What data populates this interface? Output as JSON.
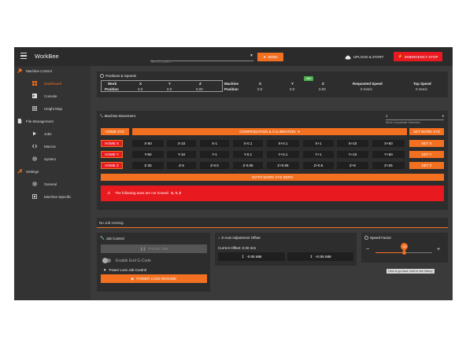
{
  "app": {
    "title": "WorkBee"
  },
  "topbar": {
    "send_placeholder": "Send code...",
    "send_label": "SEND",
    "upload_label": "UPLOAD & START",
    "estop_label": "EMERGENCY STOP",
    "accent": "#f37021",
    "danger": "#e8191f"
  },
  "sidebar": {
    "sections": [
      {
        "label": "Machine Control",
        "icon": "tools-icon",
        "items": [
          {
            "label": "Dashboard",
            "icon": "dashboard-icon",
            "active": true
          },
          {
            "label": "Console",
            "icon": "console-icon"
          },
          {
            "label": "Height Map",
            "icon": "grid-icon"
          }
        ]
      },
      {
        "label": "File Management",
        "icon": "file-icon",
        "items": [
          {
            "label": "Jobs",
            "icon": "play-icon"
          },
          {
            "label": "Macros",
            "icon": "code-icon"
          },
          {
            "label": "System",
            "icon": "gear-icon"
          }
        ]
      },
      {
        "label": "Settings",
        "icon": "wrench-icon",
        "items": [
          {
            "label": "General",
            "icon": "gear-icon"
          },
          {
            "label": "Machine-Specific",
            "icon": "chip-icon"
          }
        ]
      }
    ]
  },
  "positions": {
    "title": "Positions & Speeds",
    "status": "Idle",
    "work_label": "Work",
    "position_label": "Position",
    "machine_label": "Machine",
    "x": "X",
    "y": "Y",
    "z": "Z",
    "work_x": "0.0",
    "work_y": "0.0",
    "work_z": "0.00",
    "mach_x": "0.0",
    "mach_y": "0.0",
    "mach_z": "0.00",
    "requested_label": "Requested Speed",
    "requested_value": "0 mm/s",
    "top_label": "Top Speed",
    "top_value": "0 mm/s"
  },
  "movement": {
    "title": "Machine Movement",
    "coord_value": "1",
    "coord_caption": "Work Coordinate Selection",
    "home_all": "HOME XYZ",
    "compensation": "COMPENSATION & CALIBRATION",
    "set_work": "SET WORK XYZ",
    "rows": [
      {
        "home": "HOME X",
        "set": "SET X",
        "jogs": [
          "X-50",
          "X-10",
          "X-1",
          "X-0.1",
          "X+0.1",
          "X+1",
          "X+10",
          "X+50"
        ]
      },
      {
        "home": "HOME Y",
        "set": "SET Y",
        "jogs": [
          "Y-50",
          "Y-10",
          "Y-1",
          "Y-0.1",
          "Y+0.1",
          "Y+1",
          "Y+10",
          "Y+50"
        ]
      },
      {
        "home": "HOME Z",
        "set": "SET Z",
        "jogs": [
          "Z-25",
          "Z-5",
          "Z-0.5",
          "Z-0.05",
          "Z+0.05",
          "Z+0.5",
          "Z+5",
          "Z+25"
        ]
      }
    ],
    "goto_zero": "GOTO WORK XYZ ZERO",
    "warning": "The following axes are not homed:",
    "warning_axes": "X, Y, Z"
  },
  "job_status": "No Job running.",
  "job_control": {
    "title": "Job Control",
    "pause": "PAUSE JOB",
    "end_gcode": "Enable End G-Code",
    "power_loss_title": "Power Loss Job Control",
    "power_loss_button": "POWER LOSS RESUME"
  },
  "z_babystep": {
    "title": "Z-Axis Adjustment Offset",
    "offset_label": "Current Offset: 0.00 mm",
    "down": "-0.05 MM",
    "up": "+0.05 MM"
  },
  "speed_factor": {
    "title": "Speed Factor",
    "minus": "−",
    "plus": "+",
    "value": "100",
    "fraction": 0.5
  },
  "tooltip": "Click to go back, hold to see history"
}
